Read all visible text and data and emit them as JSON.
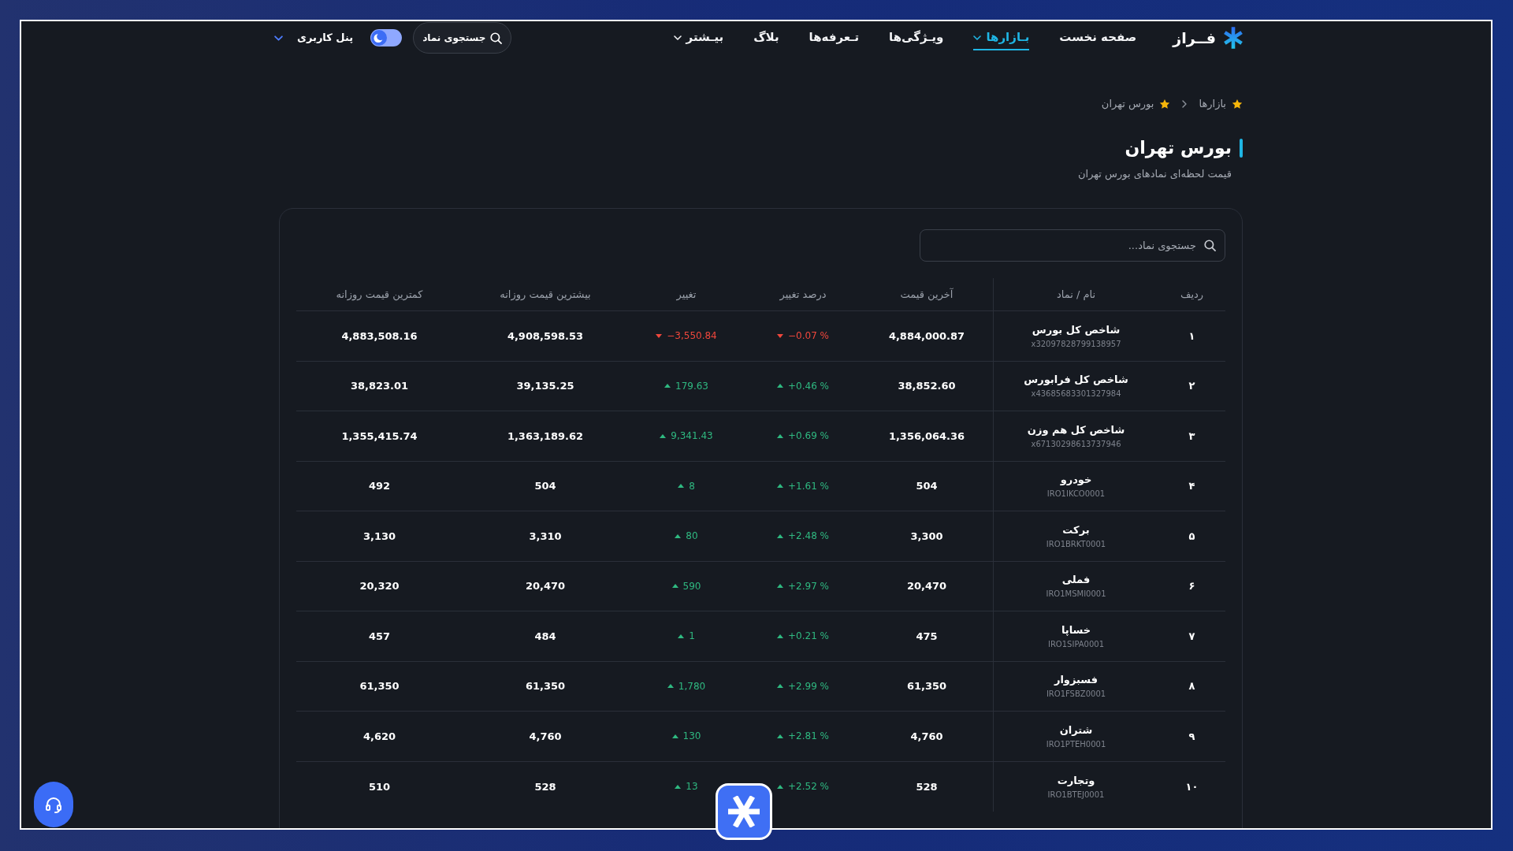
{
  "header": {
    "logo_text": "فــراز",
    "nav": [
      {
        "label": "صفحه نخست",
        "selected": false,
        "dropdown": false
      },
      {
        "label": "بـازارها",
        "selected": true,
        "dropdown": true
      },
      {
        "label": "ویـژگی‌ها",
        "selected": false,
        "dropdown": false
      },
      {
        "label": "تـعرفه‌ها",
        "selected": false,
        "dropdown": false
      },
      {
        "label": "بلاگ",
        "selected": false,
        "dropdown": false
      },
      {
        "label": "بیـشتر",
        "selected": false,
        "dropdown": true
      }
    ],
    "symbol_search_button": {
      "label": "جستجوی نماد"
    },
    "theme_toggle": {
      "on": true
    },
    "user_panel": {
      "label": "پنل کاربری"
    }
  },
  "breadcrumb": [
    {
      "label": "بازارها"
    },
    {
      "label": "بورس تهران"
    }
  ],
  "page": {
    "title": "بورس تهران",
    "subtitle": "قیمت لحظه‌ای نمادهای بورس تهران"
  },
  "table": {
    "search": {
      "placeholder": "جستجوی نماد..."
    },
    "columns": [
      "ردیف",
      "نام / نماد",
      "آخرین قیمت",
      "درصد تغییر",
      "تغییر",
      "بیشترین قیمت روزانه",
      "کمترین قیمت روزانه"
    ],
    "rows": [
      {
        "index": "۱",
        "name": "شاخص کل بورس",
        "code": "x32097828799138957",
        "last": "4,884,000.87",
        "change_pct": "−0.07 %",
        "change": "−3,550.84",
        "rising": false,
        "high": "4,908,598.53",
        "low": "4,883,508.16"
      },
      {
        "index": "۲",
        "name": "شاخص کل فرابورس",
        "code": "x43685683301327984",
        "last": "38,852.60",
        "change_pct": "+0.46 %",
        "change": "179.63",
        "rising": true,
        "high": "39,135.25",
        "low": "38,823.01"
      },
      {
        "index": "۳",
        "name": "شاخص کل هم وزن",
        "code": "x67130298613737946",
        "last": "1,356,064.36",
        "change_pct": "+0.69 %",
        "change": "9,341.43",
        "rising": true,
        "high": "1,363,189.62",
        "low": "1,355,415.74"
      },
      {
        "index": "۴",
        "name": "خودرو",
        "code": "IRO1IKCO0001",
        "last": "504",
        "change_pct": "+1.61 %",
        "change": "8",
        "rising": true,
        "high": "504",
        "low": "492"
      },
      {
        "index": "۵",
        "name": "برکت",
        "code": "IRO1BRKT0001",
        "last": "3,300",
        "change_pct": "+2.48 %",
        "change": "80",
        "rising": true,
        "high": "3,310",
        "low": "3,130"
      },
      {
        "index": "۶",
        "name": "فملی",
        "code": "IRO1MSMI0001",
        "last": "20,470",
        "change_pct": "+2.97 %",
        "change": "590",
        "rising": true,
        "high": "20,470",
        "low": "20,320"
      },
      {
        "index": "۷",
        "name": "خساپا",
        "code": "IRO1SIPA0001",
        "last": "475",
        "change_pct": "+0.21 %",
        "change": "1",
        "rising": true,
        "high": "484",
        "low": "457"
      },
      {
        "index": "۸",
        "name": "فسبزوار",
        "code": "IRO1FSBZ0001",
        "last": "61,350",
        "change_pct": "+2.99 %",
        "change": "1,780",
        "rising": true,
        "high": "61,350",
        "low": "61,350"
      },
      {
        "index": "۹",
        "name": "شتران",
        "code": "IRO1PTEH0001",
        "last": "4,760",
        "change_pct": "+2.81 %",
        "change": "130",
        "rising": true,
        "high": "4,760",
        "low": "4,620"
      },
      {
        "index": "۱۰",
        "name": "وتجارت",
        "code": "IRO1BTEJ0001",
        "last": "528",
        "change_pct": "+2.52 %",
        "change": "13",
        "rising": true,
        "high": "528",
        "low": "510"
      }
    ]
  }
}
